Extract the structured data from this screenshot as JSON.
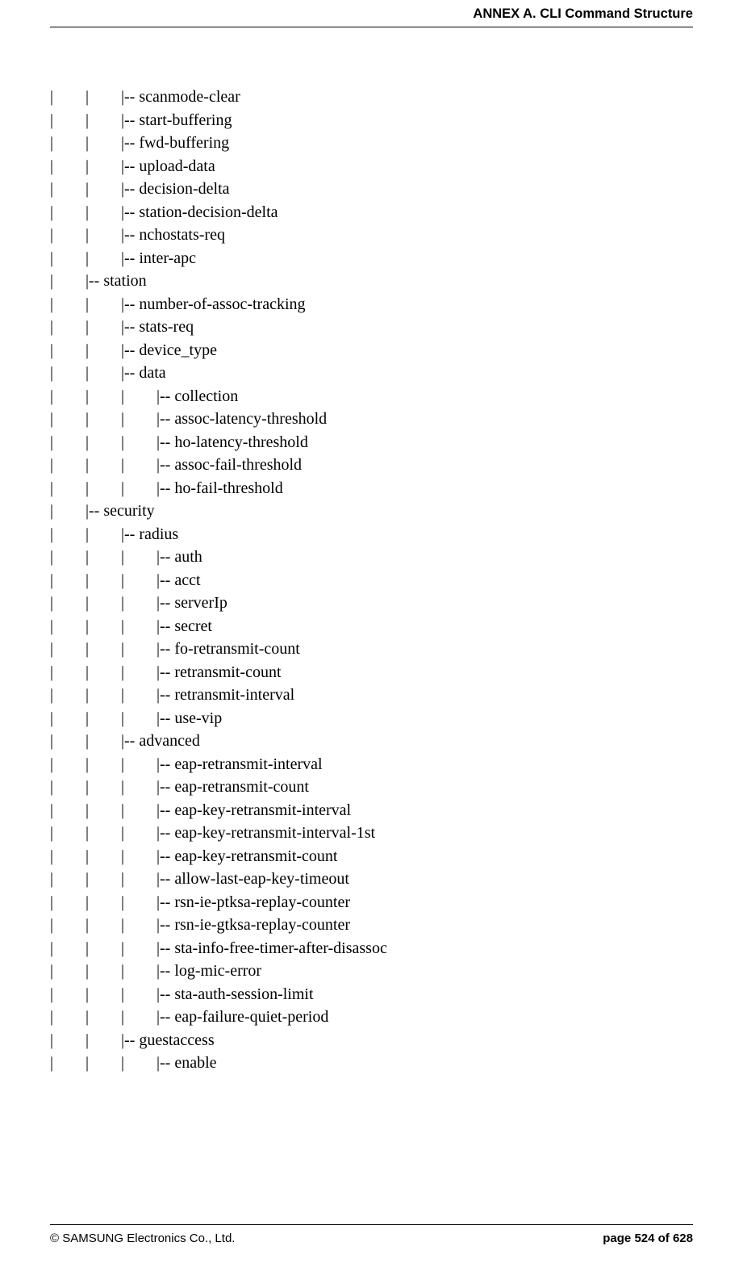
{
  "header": {
    "title": "ANNEX A. CLI Command Structure"
  },
  "tree": {
    "lines": [
      "|        |        |-- scanmode-clear",
      "|        |        |-- start-buffering",
      "|        |        |-- fwd-buffering",
      "|        |        |-- upload-data",
      "|        |        |-- decision-delta",
      "|        |        |-- station-decision-delta",
      "|        |        |-- nchostats-req",
      "|        |        |-- inter-apc",
      "|        |-- station",
      "|        |        |-- number-of-assoc-tracking",
      "|        |        |-- stats-req",
      "|        |        |-- device_type",
      "|        |        |-- data",
      "|        |        |        |-- collection",
      "|        |        |        |-- assoc-latency-threshold",
      "|        |        |        |-- ho-latency-threshold",
      "|        |        |        |-- assoc-fail-threshold",
      "|        |        |        |-- ho-fail-threshold",
      "|        |-- security",
      "|        |        |-- radius",
      "|        |        |        |-- auth",
      "|        |        |        |-- acct",
      "|        |        |        |-- serverIp",
      "|        |        |        |-- secret",
      "|        |        |        |-- fo-retransmit-count",
      "|        |        |        |-- retransmit-count",
      "|        |        |        |-- retransmit-interval",
      "|        |        |        |-- use-vip",
      "|        |        |-- advanced",
      "|        |        |        |-- eap-retransmit-interval",
      "|        |        |        |-- eap-retransmit-count",
      "|        |        |        |-- eap-key-retransmit-interval",
      "|        |        |        |-- eap-key-retransmit-interval-1st",
      "|        |        |        |-- eap-key-retransmit-count",
      "|        |        |        |-- allow-last-eap-key-timeout",
      "|        |        |        |-- rsn-ie-ptksa-replay-counter",
      "|        |        |        |-- rsn-ie-gtksa-replay-counter",
      "|        |        |        |-- sta-info-free-timer-after-disassoc",
      "|        |        |        |-- log-mic-error",
      "|        |        |        |-- sta-auth-session-limit",
      "|        |        |        |-- eap-failure-quiet-period",
      "|        |        |-- guestaccess",
      "|        |        |        |-- enable"
    ]
  },
  "footer": {
    "copyright": "© SAMSUNG Electronics Co., Ltd.",
    "page_label": "page 524 of 628"
  }
}
